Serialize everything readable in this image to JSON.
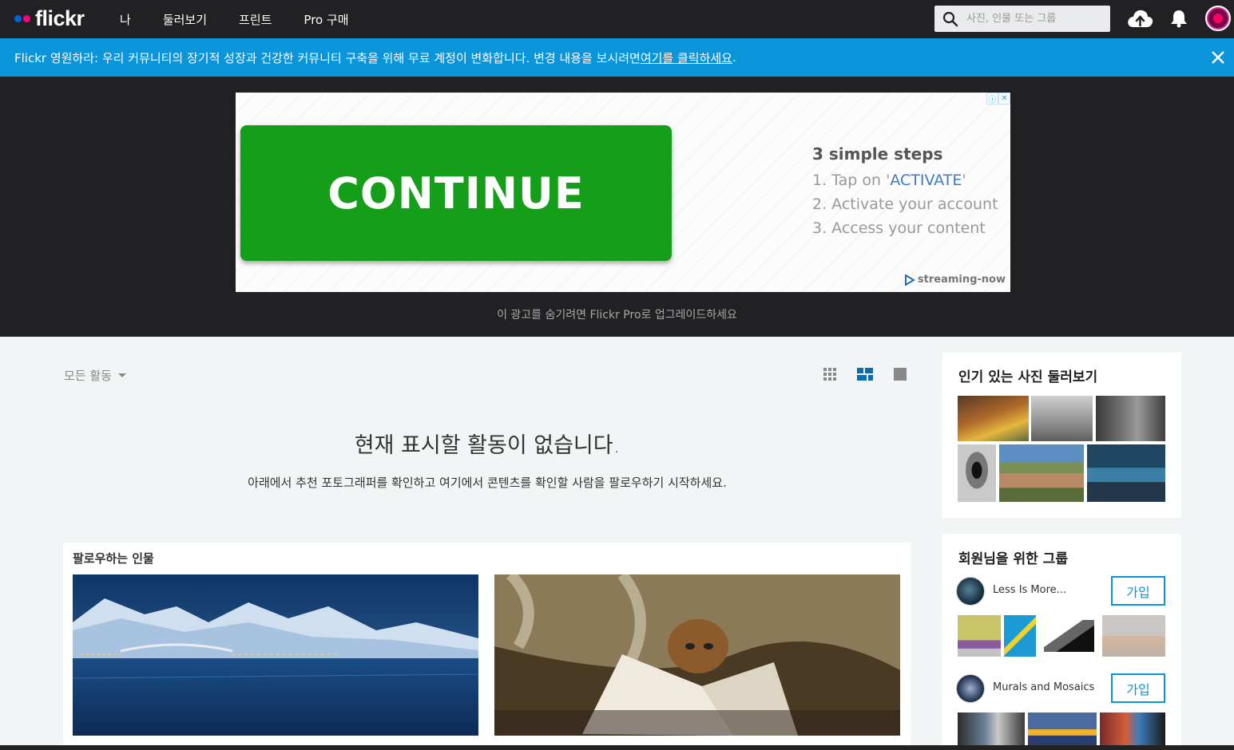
{
  "topnav": {
    "logo": "flickr",
    "links": [
      "나",
      "둘러보기",
      "프린트",
      "Pro 구매"
    ],
    "search_placeholder": "사진, 인물 또는 그룹",
    "icons": [
      "upload-icon",
      "bell-icon",
      "avatar"
    ]
  },
  "banner": {
    "text": "Flickr 영원하라: 우리 커뮤니티의 장기적 성장과 건강한 커뮤니티 구축을 위해 무료 계정이 변화합니다. 변경 내용을 보시려면 ",
    "link": "여기를 클릭하세요",
    "end": "."
  },
  "ad": {
    "button": "CONTINUE",
    "steps_title": "3 simple steps",
    "step1_pre": "1. Tap on '",
    "step1_q": "ACTIVATE",
    "step1_post": "'",
    "step2": "2. Activate your account",
    "step3": "3. Access your content",
    "brand": "streaming-now",
    "upgrade_note": "이 광고를 숨기려면 Flickr Pro로 업그레이드하세요"
  },
  "feed": {
    "filter": "모든 활동",
    "empty_title": "현재 표시할 활동이 없습니다.",
    "empty_sub": "아래에서 추천 포토그래퍼를 확인하고 여기에서 콘텐츠를 확인할 사람을 팔로우하기 시작하세요.",
    "follow_title": "팔로우하는 인물"
  },
  "sidebar": {
    "popular_title": "인기 있는 사진 둘러보기",
    "groups_title": "회원님을 위한 그룹",
    "groups": [
      {
        "name": "Less Is More...",
        "join": "가입"
      },
      {
        "name": "Murals and Mosaics",
        "join": "가입"
      }
    ]
  },
  "colors": {
    "nav_bg": "#212124",
    "banner_bg": "#0a94da",
    "accent": "#0a94da",
    "ad_button": "#159e1a"
  }
}
